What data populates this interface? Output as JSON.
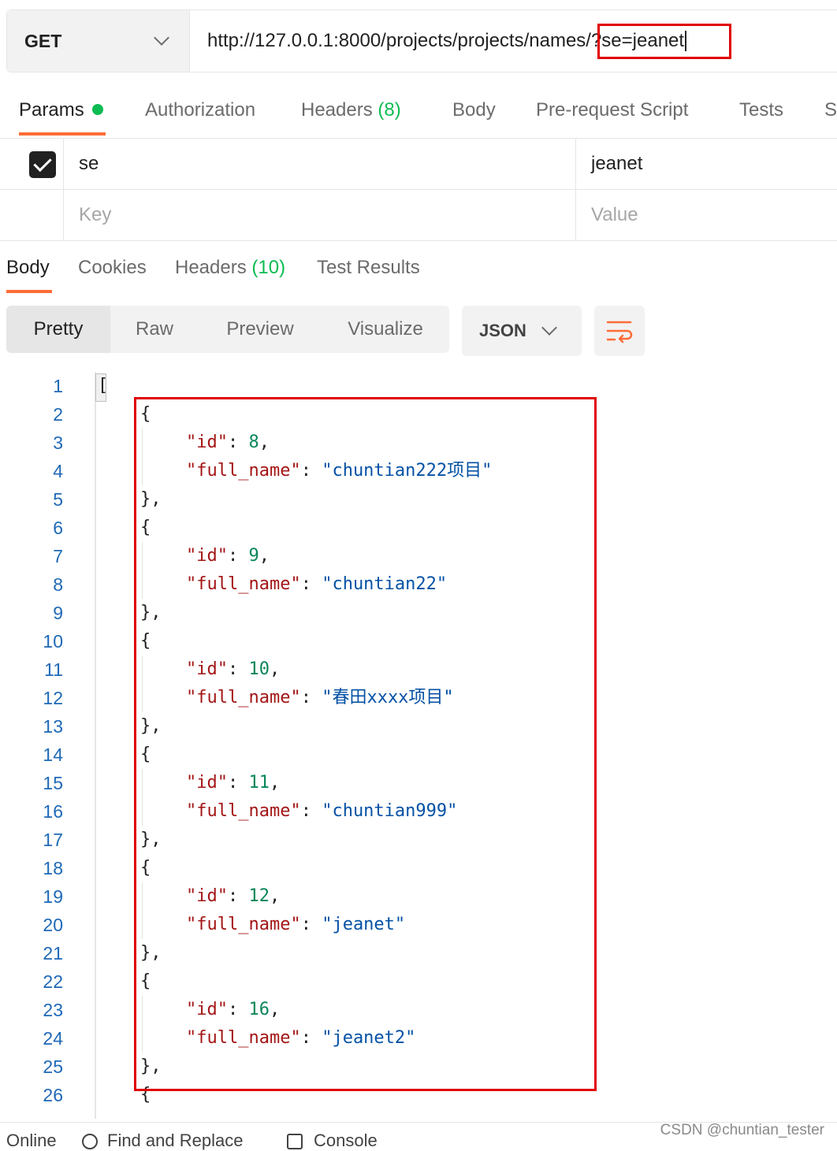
{
  "request": {
    "method": "GET",
    "url": "http://127.0.0.1:8000/projects/projects/names/?se=jeanet"
  },
  "request_tabs": [
    {
      "label": "Params",
      "active": true
    },
    {
      "label": "Authorization"
    },
    {
      "label": "Headers",
      "count": "(8)"
    },
    {
      "label": "Body"
    },
    {
      "label": "Pre-request Script"
    },
    {
      "label": "Tests"
    },
    {
      "label": "S"
    }
  ],
  "params": {
    "rows": [
      {
        "checked": true,
        "key": "se",
        "value": "jeanet"
      }
    ],
    "key_placeholder": "Key",
    "value_placeholder": "Value"
  },
  "response_tabs": [
    {
      "label": "Body",
      "active": true
    },
    {
      "label": "Cookies"
    },
    {
      "label": "Headers",
      "count": "(10)"
    },
    {
      "label": "Test Results"
    }
  ],
  "format": {
    "modes": [
      "Pretty",
      "Raw",
      "Preview",
      "Visualize"
    ],
    "active_mode": "Pretty",
    "language": "JSON",
    "wrap_icon": "wrap-lines-icon"
  },
  "code_lines": [
    "[",
    "{",
    "\"id\": 8,",
    "\"full_name\": \"chuntian222项目\"",
    "},",
    "{",
    "\"id\": 9,",
    "\"full_name\": \"chuntian22\"",
    "},",
    "{",
    "\"id\": 10,",
    "\"full_name\": \"春田xxxx项目\"",
    "},",
    "{",
    "\"id\": 11,",
    "\"full_name\": \"chuntian999\"",
    "},",
    "{",
    "\"id\": 12,",
    "\"full_name\": \"jeanet\"",
    "},",
    "{",
    "\"id\": 16,",
    "\"full_name\": \"jeanet2\"",
    "},",
    "{"
  ],
  "status_bar": {
    "online": "Online",
    "find_replace": "Find and Replace",
    "console": "Console"
  },
  "watermark": "CSDN @chuntian_tester",
  "colors": {
    "accent": "#ff6c37",
    "count_green": "#0cbb52",
    "annotation_red": "#e00000",
    "line_number_blue": "#1f69b7",
    "json_key": "#a31515",
    "json_number": "#098658",
    "json_string": "#0451a5"
  }
}
